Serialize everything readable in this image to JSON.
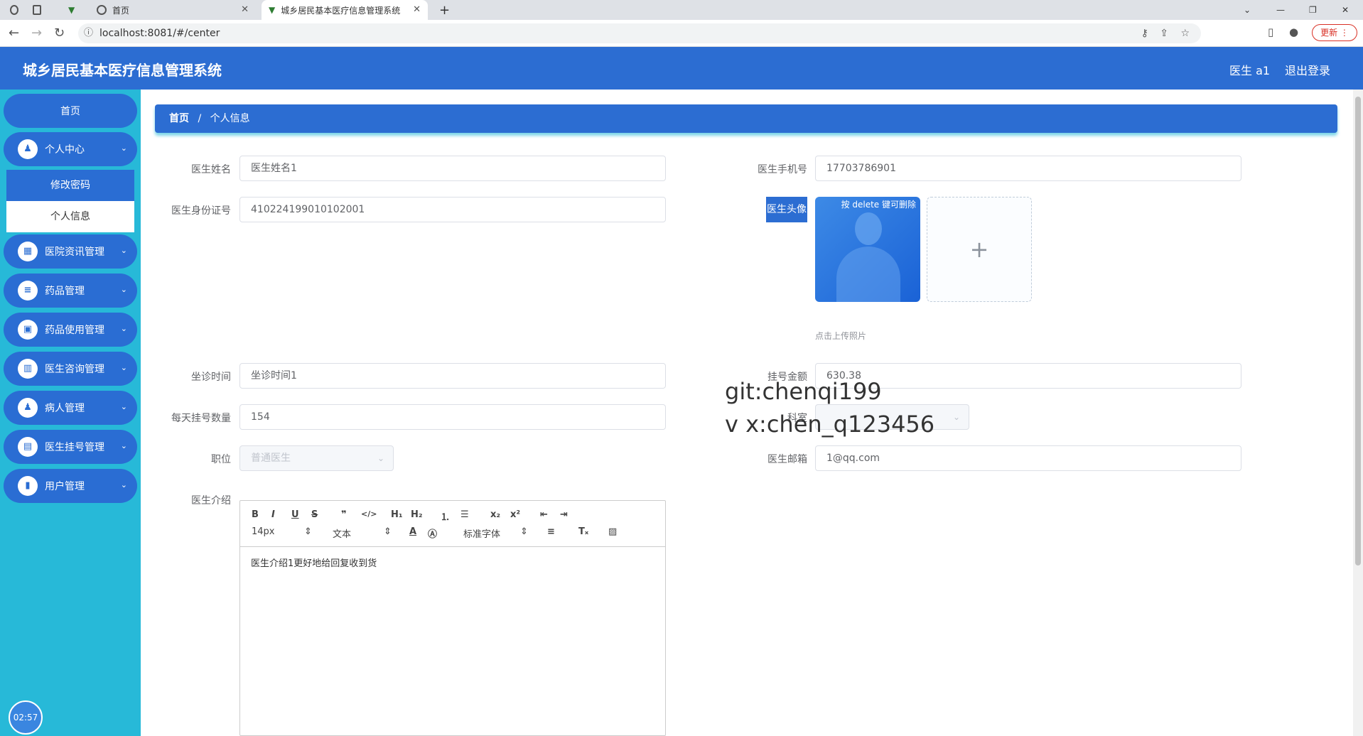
{
  "browser": {
    "tabs": [
      {
        "label": ""
      },
      {
        "label": ""
      },
      {
        "label": ""
      },
      {
        "label": "首页"
      },
      {
        "label": "城乡居民基本医疗信息管理系统"
      }
    ],
    "url": "localhost:8081/#/center",
    "update_label": "更新"
  },
  "header": {
    "title": "城乡居民基本医疗信息管理系统",
    "user": "医生 a1",
    "logout": "退出登录"
  },
  "sidebar": {
    "home": "首页",
    "items": [
      {
        "label": "个人中心",
        "icon": "user-icon"
      },
      {
        "label": "医院资讯管理",
        "icon": "grid-icon"
      },
      {
        "label": "药品管理",
        "icon": "list-icon"
      },
      {
        "label": "药品使用管理",
        "icon": "briefcase-icon"
      },
      {
        "label": "医生咨询管理",
        "icon": "chart-icon"
      },
      {
        "label": "病人管理",
        "icon": "person-icon"
      },
      {
        "label": "医生挂号管理",
        "icon": "clipboard-icon"
      },
      {
        "label": "用户管理",
        "icon": "bar-chart-icon"
      }
    ],
    "submenu": [
      "修改密码",
      "个人信息"
    ],
    "clock": "02:57"
  },
  "breadcrumb": {
    "home": "首页",
    "sep": "/",
    "current": "个人信息"
  },
  "form": {
    "name_label": "医生姓名",
    "name_value": "医生姓名1",
    "phone_label": "医生手机号",
    "phone_value": "17703786901",
    "idcard_label": "医生身份证号",
    "idcard_value": "410224199010102001",
    "avatar_label": "医生头像",
    "avatar_hint": "按 delete 键可删除",
    "upload_hint": "点击上传照片",
    "time_label": "坐诊时间",
    "time_value": "坐诊时间1",
    "fee_label": "挂号金额",
    "fee_value": "630.38",
    "count_label": "每天挂号数量",
    "count_value": "154",
    "dept_label": "科室",
    "dept_value": "",
    "position_label": "职位",
    "position_value": "普通医生",
    "email_label": "医生邮箱",
    "email_value": "1@qq.com",
    "intro_label": "医生介绍",
    "intro_value": "医生介绍1更好地给回复收到货"
  },
  "editor": {
    "size": "14px",
    "format": "文本",
    "font": "标准字体"
  },
  "watermark": {
    "line1": "git:chenqi199",
    "line2": "v x:chen_q123456"
  }
}
